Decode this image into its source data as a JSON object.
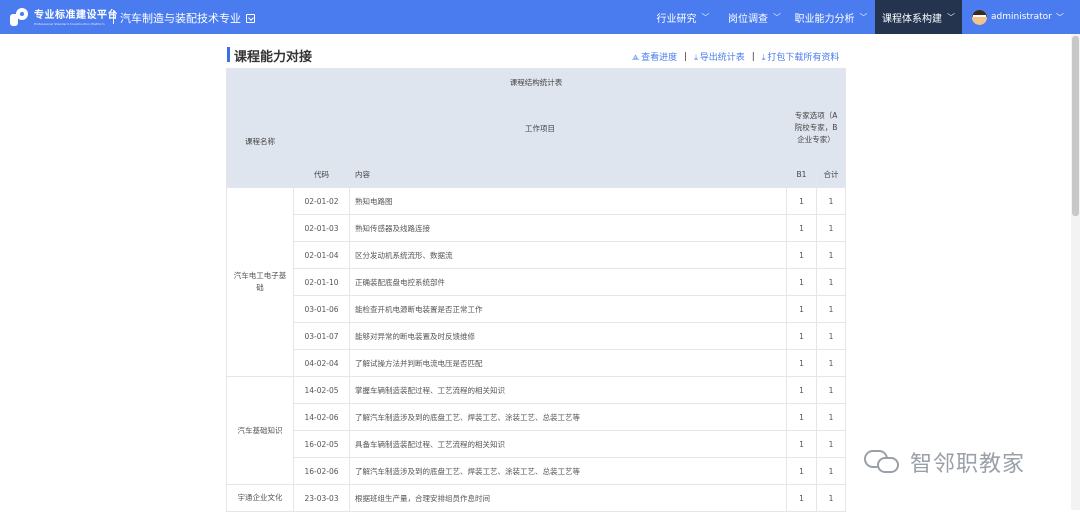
{
  "header": {
    "logo_title": "专业标准建设平台",
    "logo_subtitle": "Professional Standard Construction Platform",
    "major": "汽车制造与装配技术专业",
    "nav": [
      {
        "label": "行业研究"
      },
      {
        "label": "岗位调查"
      },
      {
        "label": "职业能力分析"
      },
      {
        "label": "课程体系构建",
        "active": true
      }
    ],
    "user": "administrator",
    "accent_color": "#4a7cf0",
    "active_color": "#24334e"
  },
  "page": {
    "title": "课程能力对接",
    "actions": [
      "查看进度",
      "导出统计表",
      "打包下载所有资料"
    ]
  },
  "table": {
    "caption": "课程结构统计表",
    "headers": {
      "course_name": "课程名称",
      "work_items": "工作项目",
      "experts": "专家选项（A院校专家，B企业专家）",
      "code": "代码",
      "content": "内容",
      "b1": "B1",
      "total": "合计"
    },
    "groups": [
      {
        "name": "汽车电工电子基础",
        "rows": [
          {
            "code": "02-01-02",
            "content": "熟知电路图",
            "b1": "1",
            "total": "1"
          },
          {
            "code": "02-01-03",
            "content": "熟知传感器及线路连接",
            "b1": "1",
            "total": "1"
          },
          {
            "code": "02-01-04",
            "content": "区分发动机系统流形、数据流",
            "b1": "1",
            "total": "1"
          },
          {
            "code": "02-01-10",
            "content": "正确装配底盘电控系统部件",
            "b1": "1",
            "total": "1"
          },
          {
            "code": "03-01-06",
            "content": "能检查开机电源断电装置是否正常工作",
            "b1": "1",
            "total": "1"
          },
          {
            "code": "03-01-07",
            "content": "能够对异常的断电装置及时反馈维修",
            "b1": "1",
            "total": "1"
          },
          {
            "code": "04-02-04",
            "content": "了解试操方法并判断电流电压是否匹配",
            "b1": "1",
            "total": "1"
          }
        ]
      },
      {
        "name": "汽车基础知识",
        "rows": [
          {
            "code": "14-02-05",
            "content": "掌握车辆制造装配过程、工艺流程的相关知识",
            "b1": "1",
            "total": "1"
          },
          {
            "code": "14-02-06",
            "content": "了解汽车制造涉及到的底盘工艺、焊装工艺、涂装工艺、总装工艺等",
            "b1": "1",
            "total": "1"
          },
          {
            "code": "16-02-05",
            "content": "具备车辆制造装配过程、工艺流程的相关知识",
            "b1": "1",
            "total": "1"
          },
          {
            "code": "16-02-06",
            "content": "了解汽车制造涉及到的底盘工艺、焊装工艺、涂装工艺、总装工艺等",
            "b1": "1",
            "total": "1"
          }
        ]
      },
      {
        "name": "宇通企业文化",
        "rows": [
          {
            "code": "23-03-03",
            "content": "根据班组生产量，合理安排组员作息时间",
            "b1": "1",
            "total": "1"
          }
        ]
      }
    ]
  },
  "watermark": "智邻职教家"
}
